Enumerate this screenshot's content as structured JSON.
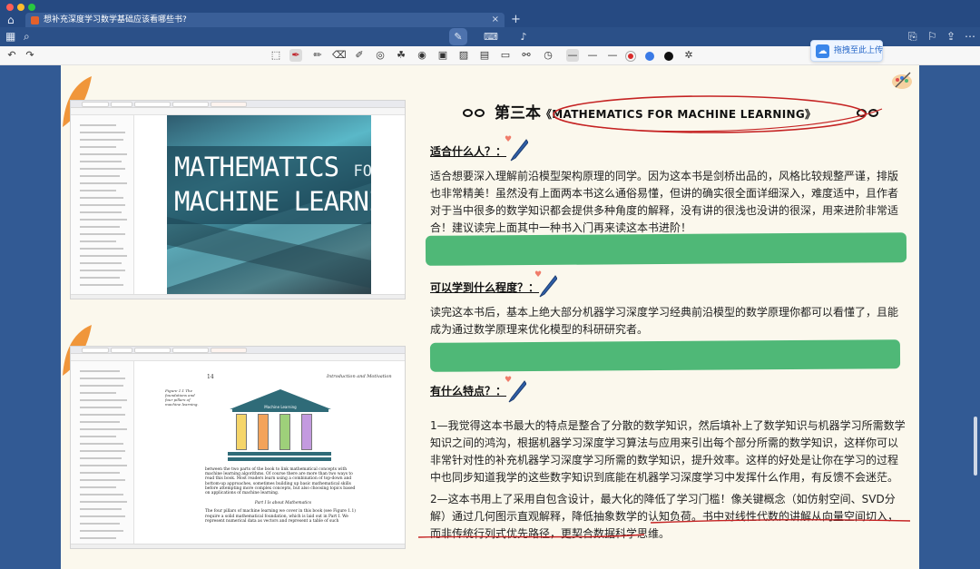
{
  "window": {
    "tab_title": "想补充深度学习数学基础应该看哪些书?",
    "close_glyph": "×",
    "add_glyph": "+"
  },
  "toolbar": {
    "upload_label": "拖拽至此上传"
  },
  "colors": {
    "pen_red": "#d92b2b",
    "pen_blue": "#3a7ae6",
    "pen_black": "#111111",
    "highlight_green": "#4fb877"
  },
  "book_cover": {
    "title_line1": "MATHEMATICS",
    "title_for": "FOR",
    "title_line2": "MACHINE LEARNING"
  },
  "book_page": {
    "page_number": "14",
    "running_head": "Introduction and Motivation",
    "figure_caption": "Figure 1.1 The foundations and four pillars of machine learning.",
    "temple_label": "Machine Learning",
    "body_text": "between the two parts of the book to link mathematical concepts with machine learning algorithms. Of course there are more than two ways to read this book. Most readers learn using a combination of top-down and bottom-up approaches, sometimes building up basic mathematical skills before attempting more complex concepts, but also choosing topics based on applications of machine learning.",
    "part_heading": "Part I Is about Mathematics",
    "part_text": "The four pillars of machine learning we cover in this book (see Figure 1.1) require a solid mathematical foundation, which is laid out in Part I. We represent numerical data as vectors and represent a table of such"
  },
  "note": {
    "heading_prefix": "第三本",
    "heading_title": "《MATHEMATICS FOR MACHINE LEARNING》",
    "section1_title": "适合什么人？：",
    "section1_text": "适合想要深入理解前沿模型架构原理的同学。因为这本书是剑桥出品的，风格比较规整严谨，排版也非常精美！虽然没有上面两本书这么通俗易懂，但讲的确实很全面详细深入，难度适中，且作者对于当中很多的数学知识都会提供多种角度的解释，没有讲的很浅也没讲的很深，用来进阶非常适合！建议读完上面其中一种书入门再来读这本书进阶！",
    "section2_title": "可以学到什么程度？：",
    "section2_text": "读完这本书后，基本上绝大部分机器学习深度学习经典前沿模型的数学原理你都可以看懂了，且能成为通过数学原理来优化模型的科研研究者。",
    "section3_title": "有什么特点？：",
    "section3_text1": "1—我觉得这本书最大的特点是整合了分散的数学知识，然后填补上了数学知识与机器学习所需数学知识之间的鸿沟，根据机器学习深度学习算法与应用来引出每个部分所需的数学知识，这样你可以非常针对性的补充机器学习深度学习所需的数学知识，提升效率。这样的好处是让你在学习的过程中也同步知道我学的这些数字知识到底能在机器学习深度学习中发挥什么作用，有反馈不会迷茫。",
    "section3_text2": "2—这本书用上了采用自包含设计，最大化的降低了学习门槛！像关键概念（如仿射空间、SVD分解）通过几何图示直观解释，降低抽象数学的认知负荷。书中对线性代数的讲解从向量空间切入，而非传统行列式优先路径，更契合数据科学思维。"
  }
}
